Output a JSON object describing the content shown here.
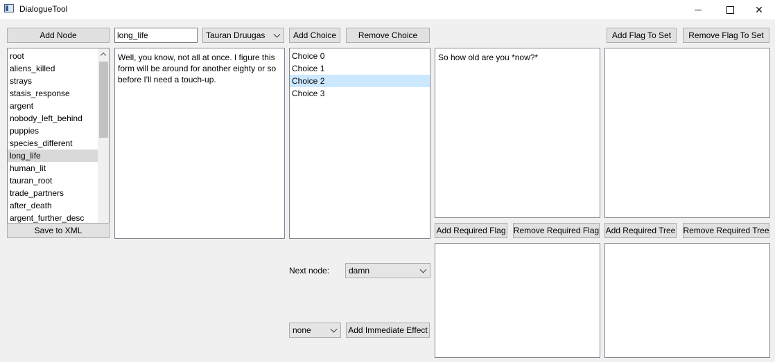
{
  "window": {
    "title": "DialogueTool"
  },
  "left": {
    "add_node_label": "Add Node",
    "nodes": [
      "root",
      "aliens_killed",
      "strays",
      "stasis_response",
      "argent",
      "nobody_left_behind",
      "puppies",
      "species_different",
      "long_life",
      "human_lit",
      "tauran_root",
      "trade_partners",
      "after_death",
      "argent_further_desc"
    ],
    "selected_index": 8,
    "save_label": "Save to XML"
  },
  "node": {
    "name_value": "long_life",
    "speaker_selected": "Tauran Druugas",
    "text": "Well, you know, not all at once. I figure this form will be around for another eighty or so before I'll need a touch-up."
  },
  "choices": {
    "add_label": "Add Choice",
    "remove_label": "Remove Choice",
    "items": [
      "Choice 0",
      "Choice 1",
      "Choice 2",
      "Choice 3"
    ],
    "selected_index": 2,
    "choice_text": "So how old are you *now?*",
    "next_node_label": "Next node:",
    "next_node_value": "damn",
    "effect_value": "none",
    "add_effect_label": "Add Immediate Effect"
  },
  "flags": {
    "add_flag_to_set": "Add Flag To Set",
    "remove_flag_to_set": "Remove Flag To Set",
    "add_required_flag": "Add Required Flag",
    "remove_required_flag": "Remove Required Flag",
    "add_required_tree": "Add Required Tree",
    "remove_required_tree": "Remove Required Tree"
  },
  "colors": {
    "selected_gray": "#d9d9d9",
    "selected_blue": "#cce8ff"
  }
}
